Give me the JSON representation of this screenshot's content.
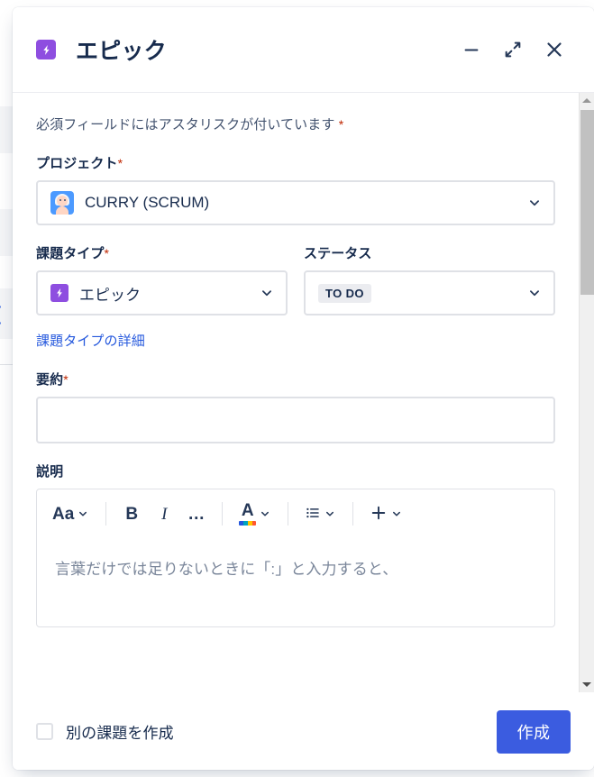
{
  "window": {
    "title": "エピック",
    "type_icon": "epic-lightning-icon",
    "controls": {
      "minimize": "minimize-icon",
      "expand": "expand-icon",
      "close": "close-icon"
    }
  },
  "form": {
    "required_note": "必須フィールドにはアスタリスクが付いています",
    "required_marker": "*",
    "project": {
      "label": "プロジェクト",
      "required": "*",
      "value": "CURRY (SCRUM)",
      "avatar": "project-avatar-icon"
    },
    "issue_type": {
      "label": "課題タイプ",
      "required": "*",
      "value": "エピック",
      "icon": "epic-lightning-icon"
    },
    "status": {
      "label": "ステータス",
      "value": "TO DO"
    },
    "issue_type_link": "課題タイプの詳細",
    "summary": {
      "label": "要約",
      "required": "*",
      "value": "",
      "placeholder": ""
    },
    "description": {
      "label": "説明",
      "placeholder": "言葉だけでは足りないときに「:」と入力すると、",
      "toolbar": {
        "text_style": "Aa",
        "bold": "B",
        "italic": "I",
        "more": "…",
        "text_color": "A",
        "list": "bulleted-list-icon",
        "insert": "plus-icon",
        "color_swatches": [
          "#2558dd",
          "#00a3bf",
          "#ffc400",
          "#ff5630"
        ]
      }
    }
  },
  "footer": {
    "create_another_label": "別の課題を作成",
    "create_another_checked": false,
    "submit_label": "作成"
  },
  "colors": {
    "epic_purple": "#8e4ee0",
    "primary_blue": "#3b5ce0",
    "link_blue": "#2558dd",
    "required_red": "#bf2600",
    "text_navy": "#172b4d",
    "border_grey": "#dfe1e6"
  },
  "scrollbar": {
    "up_arrow": "scroll-up-arrow-icon",
    "down_arrow": "scroll-down-arrow-icon"
  },
  "background": {
    "glyph": "["
  }
}
